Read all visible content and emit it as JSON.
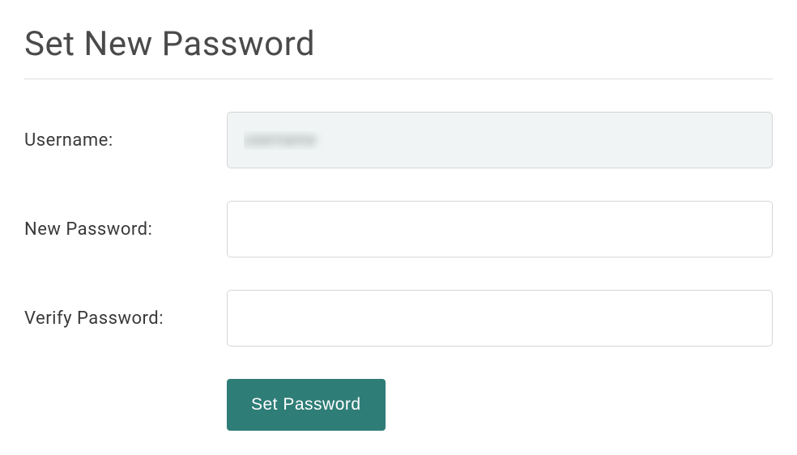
{
  "page": {
    "title": "Set New Password"
  },
  "form": {
    "username": {
      "label": "Username:",
      "value": "username"
    },
    "new_password": {
      "label": "New Password:",
      "value": ""
    },
    "verify_password": {
      "label": "Verify Password:",
      "value": ""
    },
    "submit_label": "Set Password"
  }
}
